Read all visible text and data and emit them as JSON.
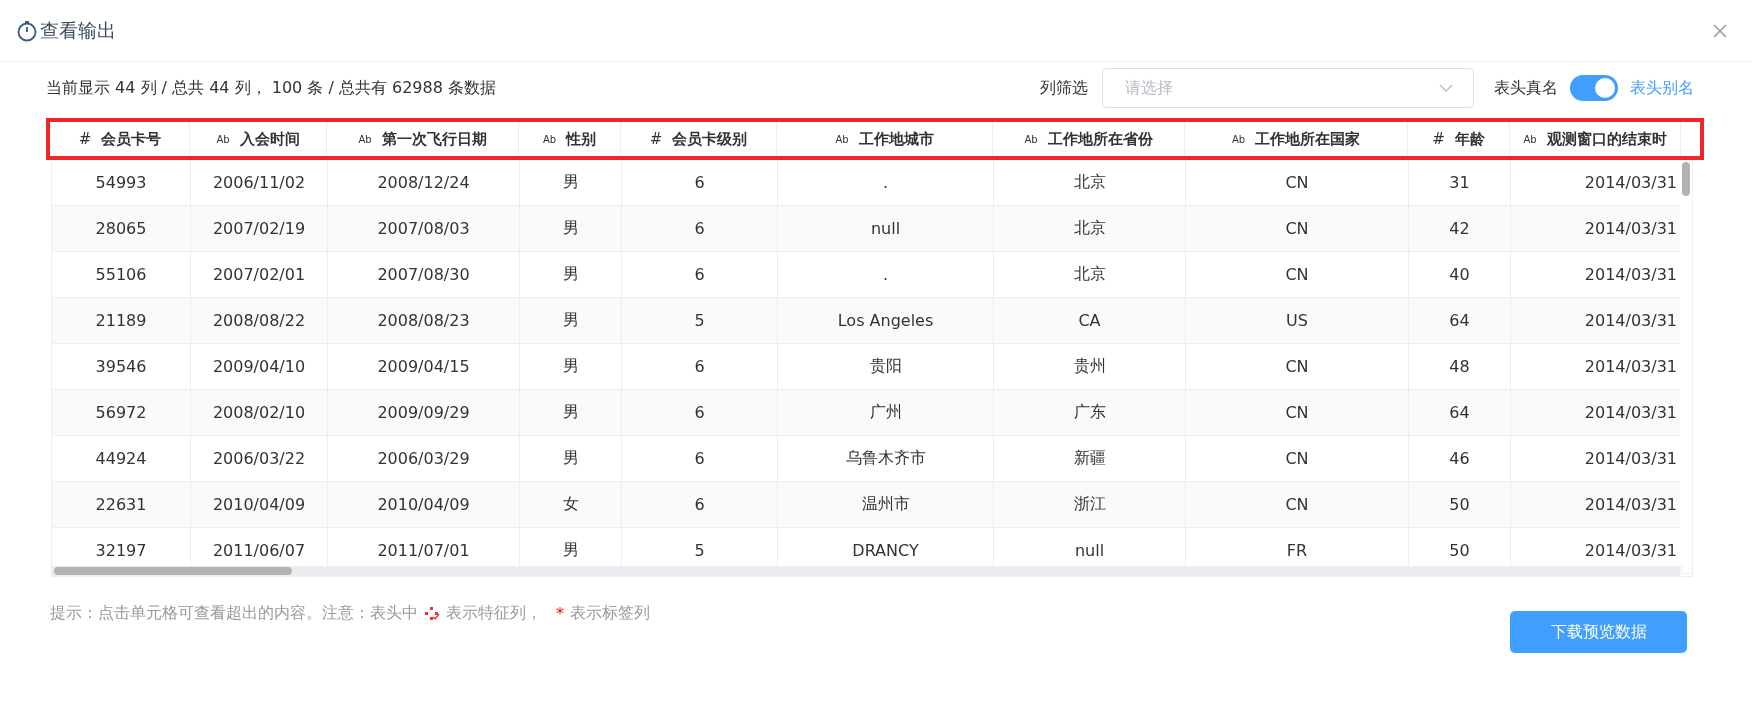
{
  "dialog": {
    "title": "查看输出"
  },
  "summary": "当前显示 44 列 / 总共 44 列， 100 条 / 总共有 62988 条数据",
  "column_filter": {
    "label": "列筛选",
    "placeholder": "请选择"
  },
  "header_toggle": {
    "off_label": "表头真名",
    "on_label": "表头别名",
    "on": true
  },
  "table": {
    "columns": [
      {
        "kind": "number",
        "icon": "#",
        "label": "会员卡号"
      },
      {
        "kind": "text",
        "icon": "Ab",
        "label": "入会时间"
      },
      {
        "kind": "text",
        "icon": "Ab",
        "label": "第一次飞行日期"
      },
      {
        "kind": "text",
        "icon": "Ab",
        "label": "性别"
      },
      {
        "kind": "number",
        "icon": "#",
        "label": "会员卡级别"
      },
      {
        "kind": "text",
        "icon": "Ab",
        "label": "工作地城市"
      },
      {
        "kind": "text",
        "icon": "Ab",
        "label": "工作地所在省份"
      },
      {
        "kind": "text",
        "icon": "Ab",
        "label": "工作地所在国家"
      },
      {
        "kind": "number",
        "icon": "#",
        "label": "年龄"
      },
      {
        "kind": "text",
        "icon": "Ab",
        "label": "观测窗口的结束时"
      }
    ],
    "rows": [
      [
        "54993",
        "2006/11/02",
        "2008/12/24",
        "男",
        "6",
        ".",
        "北京",
        "CN",
        "31",
        "2014/03/31"
      ],
      [
        "28065",
        "2007/02/19",
        "2007/08/03",
        "男",
        "6",
        "null",
        "北京",
        "CN",
        "42",
        "2014/03/31"
      ],
      [
        "55106",
        "2007/02/01",
        "2007/08/30",
        "男",
        "6",
        ".",
        "北京",
        "CN",
        "40",
        "2014/03/31"
      ],
      [
        "21189",
        "2008/08/22",
        "2008/08/23",
        "男",
        "5",
        "Los Angeles",
        "CA",
        "US",
        "64",
        "2014/03/31"
      ],
      [
        "39546",
        "2009/04/10",
        "2009/04/15",
        "男",
        "6",
        "贵阳",
        "贵州",
        "CN",
        "48",
        "2014/03/31"
      ],
      [
        "56972",
        "2008/02/10",
        "2009/09/29",
        "男",
        "6",
        "广州",
        "广东",
        "CN",
        "64",
        "2014/03/31"
      ],
      [
        "44924",
        "2006/03/22",
        "2006/03/29",
        "男",
        "6",
        "乌鲁木齐市",
        "新疆",
        "CN",
        "46",
        "2014/03/31"
      ],
      [
        "22631",
        "2010/04/09",
        "2010/04/09",
        "女",
        "6",
        "温州市",
        "浙江",
        "CN",
        "50",
        "2014/03/31"
      ],
      [
        "32197",
        "2011/06/07",
        "2011/07/01",
        "男",
        "5",
        "DRANCY",
        "null",
        "FR",
        "50",
        "2014/03/31"
      ]
    ]
  },
  "hint": {
    "lead": "提示：点击单元格可查看超出的内容。注意：表头中",
    "feature_note": "表示特征列，",
    "label_mark": "*",
    "label_note": "表示标签列"
  },
  "download_button": "下载预览数据"
}
